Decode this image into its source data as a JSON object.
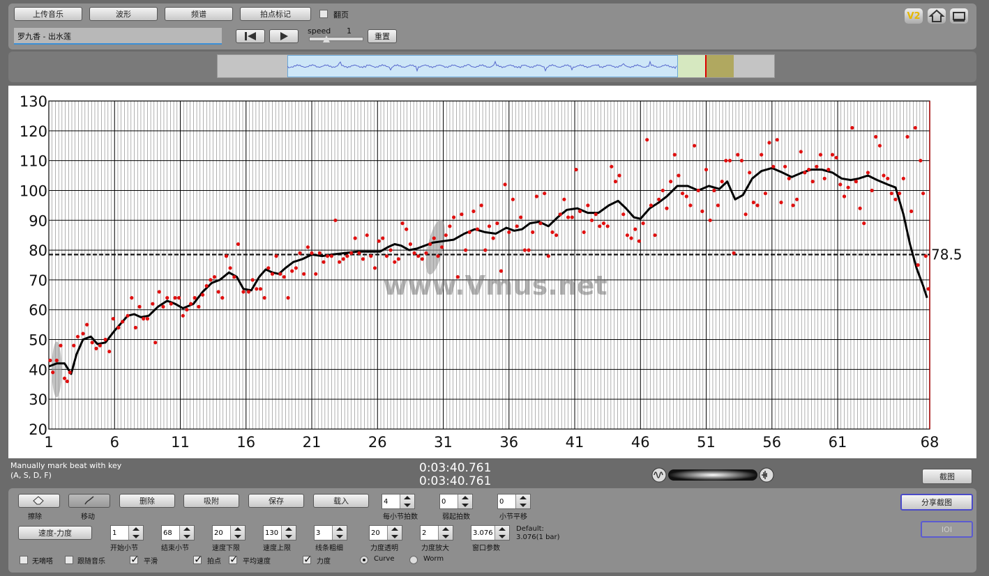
{
  "toolbar": {
    "upload_label": "上传音乐",
    "waveform_label": "波形",
    "spectrum_label": "频谱",
    "beat_mark_label": "拍点标记",
    "page_turn_label": "翻页",
    "song_title": "罗九香 - 出水莲",
    "speed_label": "speed",
    "speed_value": "1",
    "reset_label": "重置",
    "v2_label": "V2"
  },
  "chart_data": {
    "type": "scatter",
    "x_ticks": [
      "1",
      "6",
      "11",
      "16",
      "21",
      "26",
      "31",
      "36",
      "41",
      "46",
      "51",
      "56",
      "61",
      "68"
    ],
    "y_ticks": [
      "20",
      "30",
      "40",
      "50",
      "60",
      "70",
      "80",
      "90",
      "100",
      "110",
      "120",
      "130"
    ],
    "xlim": [
      1,
      68
    ],
    "ylim": [
      20,
      130
    ],
    "average_value": 78.5,
    "average_label": "78.5",
    "watermark": "www.Vmus.net",
    "curve": [
      [
        1,
        41
      ],
      [
        1.6,
        42
      ],
      [
        2.2,
        42
      ],
      [
        2.7,
        38.5
      ],
      [
        3.1,
        45
      ],
      [
        3.6,
        50
      ],
      [
        4.2,
        51
      ],
      [
        4.7,
        48.5
      ],
      [
        5.3,
        49
      ],
      [
        6,
        53
      ],
      [
        6.6,
        56
      ],
      [
        7,
        58
      ],
      [
        7.5,
        58.5
      ],
      [
        8,
        57.5
      ],
      [
        8.6,
        58
      ],
      [
        9.3,
        61
      ],
      [
        10,
        63
      ],
      [
        10.6,
        62
      ],
      [
        11.2,
        60.5
      ],
      [
        12,
        62
      ],
      [
        12.7,
        66
      ],
      [
        13.4,
        69
      ],
      [
        14,
        70
      ],
      [
        14.7,
        72.5
      ],
      [
        15.3,
        71
      ],
      [
        15.8,
        67
      ],
      [
        16.4,
        66.5
      ],
      [
        17,
        71
      ],
      [
        17.5,
        73.5
      ],
      [
        18,
        72.5
      ],
      [
        18.5,
        72
      ],
      [
        19,
        74
      ],
      [
        19.6,
        76
      ],
      [
        20.3,
        77
      ],
      [
        21,
        78.5
      ],
      [
        21.8,
        78
      ],
      [
        22.5,
        78.5
      ],
      [
        23.5,
        79
      ],
      [
        24.5,
        79.5
      ],
      [
        25.5,
        79.5
      ],
      [
        26.2,
        79.5
      ],
      [
        26.8,
        81
      ],
      [
        27.3,
        82
      ],
      [
        27.8,
        81.5
      ],
      [
        28.4,
        80
      ],
      [
        29,
        80.5
      ],
      [
        29.6,
        81.5
      ],
      [
        30.2,
        82.5
      ],
      [
        31,
        83
      ],
      [
        31.8,
        83.5
      ],
      [
        32.6,
        85.5
      ],
      [
        33.4,
        87
      ],
      [
        34.2,
        86
      ],
      [
        35,
        85.5
      ],
      [
        35.8,
        87.5
      ],
      [
        36.4,
        86.5
      ],
      [
        37,
        87
      ],
      [
        37.6,
        89
      ],
      [
        38.3,
        89.5
      ],
      [
        39,
        88
      ],
      [
        39.7,
        91
      ],
      [
        40.4,
        93.5
      ],
      [
        41.2,
        94
      ],
      [
        42,
        92.5
      ],
      [
        42.8,
        92.5
      ],
      [
        43.6,
        95
      ],
      [
        44.3,
        96.5
      ],
      [
        44.9,
        94
      ],
      [
        45.5,
        91
      ],
      [
        46,
        90.5
      ],
      [
        46.7,
        94
      ],
      [
        47.4,
        96
      ],
      [
        48,
        98
      ],
      [
        48.8,
        101.5
      ],
      [
        49.6,
        101.5
      ],
      [
        50.4,
        100
      ],
      [
        51.2,
        101.5
      ],
      [
        52,
        100.5
      ],
      [
        52.6,
        103
      ],
      [
        53.2,
        97
      ],
      [
        53.8,
        98.5
      ],
      [
        54.5,
        104
      ],
      [
        55.2,
        106.5
      ],
      [
        56,
        107.5
      ],
      [
        56.8,
        106
      ],
      [
        57.5,
        104.5
      ],
      [
        58.3,
        106
      ],
      [
        59,
        107
      ],
      [
        59.8,
        107
      ],
      [
        60.6,
        106
      ],
      [
        61.3,
        104
      ],
      [
        62,
        103.5
      ],
      [
        62.6,
        104
      ],
      [
        63.3,
        105
      ],
      [
        64,
        103.5
      ],
      [
        64.8,
        102
      ],
      [
        65.4,
        101
      ],
      [
        66,
        92
      ],
      [
        66.5,
        82
      ],
      [
        67,
        74
      ],
      [
        67.5,
        68
      ],
      [
        67.8,
        64
      ]
    ],
    "points": [
      [
        1.1,
        43
      ],
      [
        1.3,
        39
      ],
      [
        1.6,
        43
      ],
      [
        1.9,
        48
      ],
      [
        2.2,
        37
      ],
      [
        2.4,
        36
      ],
      [
        2.6,
        39
      ],
      [
        2.9,
        48
      ],
      [
        3.2,
        51
      ],
      [
        3.6,
        52
      ],
      [
        3.9,
        55
      ],
      [
        4.3,
        49
      ],
      [
        4.6,
        47
      ],
      [
        4.9,
        48
      ],
      [
        5.3,
        50
      ],
      [
        5.6,
        46
      ],
      [
        5.9,
        57
      ],
      [
        6.3,
        54
      ],
      [
        6.6,
        56
      ],
      [
        7,
        58
      ],
      [
        7.3,
        64
      ],
      [
        7.6,
        54
      ],
      [
        7.9,
        61
      ],
      [
        8.2,
        57
      ],
      [
        8.5,
        57
      ],
      [
        8.9,
        62
      ],
      [
        9.1,
        49
      ],
      [
        9.4,
        66
      ],
      [
        9.7,
        61
      ],
      [
        10,
        64
      ],
      [
        10.3,
        62
      ],
      [
        10.6,
        64
      ],
      [
        10.9,
        64
      ],
      [
        11.2,
        58
      ],
      [
        11.5,
        60
      ],
      [
        11.8,
        62
      ],
      [
        12.1,
        64
      ],
      [
        12.4,
        61
      ],
      [
        12.7,
        65
      ],
      [
        13,
        68
      ],
      [
        13.3,
        70
      ],
      [
        13.6,
        71
      ],
      [
        13.9,
        66
      ],
      [
        14.2,
        64
      ],
      [
        14.5,
        78
      ],
      [
        14.8,
        74
      ],
      [
        15.1,
        71
      ],
      [
        15.4,
        82
      ],
      [
        15.8,
        66
      ],
      [
        16.2,
        66
      ],
      [
        16.5,
        70
      ],
      [
        16.8,
        67
      ],
      [
        17.1,
        67
      ],
      [
        17.4,
        64
      ],
      [
        17.7,
        74
      ],
      [
        18,
        72
      ],
      [
        18.3,
        78
      ],
      [
        18.6,
        72
      ],
      [
        18.9,
        71
      ],
      [
        19.2,
        64
      ],
      [
        19.5,
        73
      ],
      [
        19.8,
        74
      ],
      [
        20.1,
        79
      ],
      [
        20.4,
        72
      ],
      [
        20.7,
        81
      ],
      [
        21,
        79
      ],
      [
        21.3,
        72
      ],
      [
        21.6,
        79
      ],
      [
        21.9,
        76
      ],
      [
        22.2,
        78
      ],
      [
        22.5,
        78
      ],
      [
        22.8,
        90
      ],
      [
        23.1,
        76
      ],
      [
        23.4,
        77
      ],
      [
        23.7,
        78
      ],
      [
        24,
        79
      ],
      [
        24.3,
        84
      ],
      [
        24.6,
        79
      ],
      [
        24.9,
        77
      ],
      [
        25.2,
        85
      ],
      [
        25.5,
        78
      ],
      [
        25.8,
        74
      ],
      [
        26.1,
        83
      ],
      [
        26.4,
        84
      ],
      [
        26.7,
        78
      ],
      [
        27,
        80
      ],
      [
        27.3,
        76
      ],
      [
        27.6,
        77
      ],
      [
        27.9,
        89
      ],
      [
        28.2,
        87
      ],
      [
        28.5,
        82
      ],
      [
        28.8,
        79
      ],
      [
        29.1,
        78
      ],
      [
        29.4,
        77
      ],
      [
        29.7,
        79
      ],
      [
        30,
        82
      ],
      [
        30.3,
        84
      ],
      [
        30.6,
        78
      ],
      [
        30.9,
        81
      ],
      [
        31.2,
        85
      ],
      [
        31.5,
        88
      ],
      [
        31.8,
        91
      ],
      [
        32.1,
        71
      ],
      [
        32.4,
        92
      ],
      [
        32.7,
        80
      ],
      [
        33,
        86
      ],
      [
        33.3,
        93
      ],
      [
        33.6,
        87
      ],
      [
        33.9,
        95
      ],
      [
        34.2,
        80
      ],
      [
        34.5,
        88
      ],
      [
        34.8,
        84
      ],
      [
        35.1,
        89
      ],
      [
        35.4,
        73
      ],
      [
        35.7,
        102
      ],
      [
        36,
        86
      ],
      [
        36.3,
        97
      ],
      [
        36.6,
        88
      ],
      [
        36.9,
        91
      ],
      [
        37.2,
        80
      ],
      [
        37.5,
        80
      ],
      [
        37.8,
        86
      ],
      [
        38.1,
        98
      ],
      [
        38.4,
        89
      ],
      [
        38.7,
        99
      ],
      [
        39,
        78
      ],
      [
        39.3,
        86
      ],
      [
        39.6,
        85
      ],
      [
        39.9,
        92
      ],
      [
        40.2,
        97
      ],
      [
        40.5,
        91
      ],
      [
        40.8,
        91
      ],
      [
        41.1,
        107
      ],
      [
        41.4,
        93
      ],
      [
        41.7,
        86
      ],
      [
        42,
        95
      ],
      [
        42.3,
        90
      ],
      [
        42.6,
        92
      ],
      [
        42.9,
        88
      ],
      [
        43.2,
        89
      ],
      [
        43.5,
        88
      ],
      [
        43.8,
        108
      ],
      [
        44.1,
        103
      ],
      [
        44.4,
        105
      ],
      [
        44.7,
        92
      ],
      [
        45,
        85
      ],
      [
        45.3,
        84
      ],
      [
        45.6,
        87
      ],
      [
        45.9,
        83
      ],
      [
        46.2,
        89
      ],
      [
        46.5,
        117
      ],
      [
        46.8,
        95
      ],
      [
        47.1,
        85
      ],
      [
        47.4,
        97
      ],
      [
        47.7,
        100
      ],
      [
        48,
        94
      ],
      [
        48.3,
        103
      ],
      [
        48.6,
        112
      ],
      [
        48.9,
        105
      ],
      [
        49.2,
        99
      ],
      [
        49.5,
        98
      ],
      [
        49.8,
        95
      ],
      [
        50.1,
        115
      ],
      [
        50.4,
        100
      ],
      [
        50.7,
        93
      ],
      [
        51,
        107
      ],
      [
        51.3,
        90
      ],
      [
        51.6,
        100
      ],
      [
        51.9,
        95
      ],
      [
        52.2,
        103
      ],
      [
        52.5,
        110
      ],
      [
        52.8,
        110
      ],
      [
        53.1,
        79
      ],
      [
        53.4,
        112
      ],
      [
        53.7,
        110
      ],
      [
        54,
        92
      ],
      [
        54.3,
        106
      ],
      [
        54.6,
        96
      ],
      [
        54.9,
        95
      ],
      [
        55.2,
        112
      ],
      [
        55.5,
        99
      ],
      [
        55.8,
        116
      ],
      [
        56.1,
        108
      ],
      [
        56.4,
        117
      ],
      [
        56.7,
        96
      ],
      [
        57,
        108
      ],
      [
        57.3,
        104
      ],
      [
        57.6,
        95
      ],
      [
        57.9,
        97
      ],
      [
        58.2,
        113
      ],
      [
        58.5,
        106
      ],
      [
        58.8,
        107
      ],
      [
        59.1,
        103
      ],
      [
        59.4,
        108
      ],
      [
        59.7,
        112
      ],
      [
        60,
        104
      ],
      [
        60.3,
        107
      ],
      [
        60.6,
        112
      ],
      [
        60.9,
        111
      ],
      [
        61.2,
        102
      ],
      [
        61.5,
        98
      ],
      [
        61.8,
        101
      ],
      [
        62.1,
        121
      ],
      [
        62.4,
        103
      ],
      [
        62.7,
        94
      ],
      [
        63,
        89
      ],
      [
        63.3,
        106
      ],
      [
        63.6,
        100
      ],
      [
        63.9,
        118
      ],
      [
        64.2,
        115
      ],
      [
        64.5,
        105
      ],
      [
        64.8,
        104
      ],
      [
        65.1,
        99
      ],
      [
        65.4,
        97
      ],
      [
        65.7,
        99
      ],
      [
        66,
        104
      ],
      [
        66.3,
        118
      ],
      [
        66.6,
        93
      ],
      [
        66.9,
        121
      ],
      [
        67.1,
        75
      ],
      [
        67.3,
        110
      ],
      [
        67.5,
        99
      ],
      [
        67.7,
        78
      ],
      [
        67.9,
        67
      ]
    ]
  },
  "status": {
    "hint_line1": "Manually mark beat with key",
    "hint_line2": "(A, S, D, F)",
    "time1": "0:03:40.761",
    "time2": "0:03:40.761",
    "screenshot_label": "截图"
  },
  "controls": {
    "erase_label": "擦除",
    "move_label": "移动",
    "delete_label": "删除",
    "snap_label": "吸附",
    "save_label": "保存",
    "load_label": "载入",
    "beats_per_bar_value": "4",
    "beats_per_bar_label": "每小节拍数",
    "upbeat_value": "0",
    "upbeat_label": "弱起拍数",
    "bar_shift_value": "0",
    "bar_shift_label": "小节平移",
    "share_label": "分享截图",
    "ioi_label": "IOI",
    "tempo_dyn_label": "速度-力度",
    "start_bar_value": "1",
    "start_bar_label": "开始小节",
    "end_bar_value": "68",
    "end_bar_label": "结束小节",
    "speed_low_value": "20",
    "speed_low_label": "速度下限",
    "speed_high_value": "130",
    "speed_high_label": "速度上限",
    "line_width_value": "3",
    "line_width_label": "线条粗细",
    "dyn_alpha_value": "20",
    "dyn_alpha_label": "力度透明",
    "dyn_scale_value": "2",
    "dyn_scale_label": "力度放大",
    "window_value": "3.076",
    "window_label": "窗口参数",
    "default_line1": "Default:",
    "default_line2": "3.076(1 bar)",
    "no_tick_label": "无嘀嗒",
    "follow_music_label": "跟随音乐",
    "smooth_label": "平滑",
    "beat_points_label": "拍点",
    "avg_speed_label": "平均速度",
    "dynamics_label": "力度",
    "curve_label": "Curve",
    "worm_label": "Worm"
  }
}
